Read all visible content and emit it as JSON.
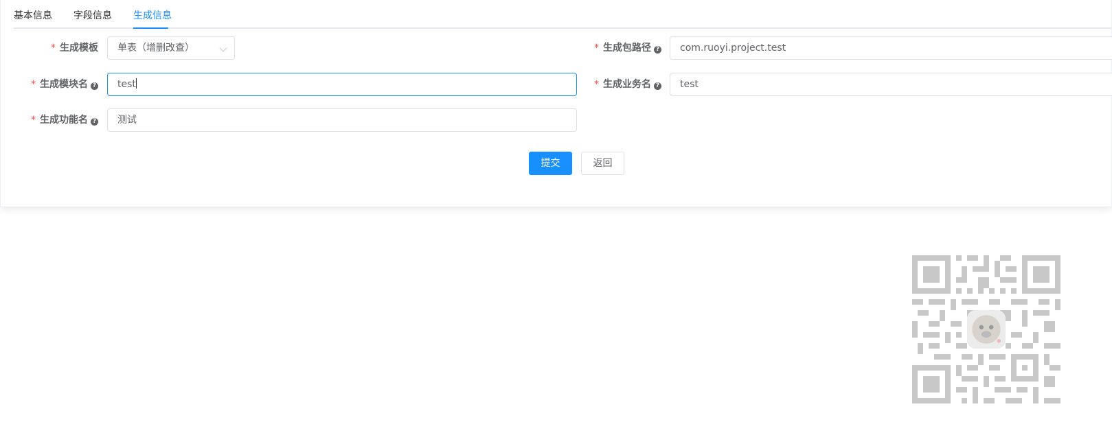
{
  "tabs": [
    {
      "label": "基本信息"
    },
    {
      "label": "字段信息"
    },
    {
      "label": "生成信息"
    }
  ],
  "form": {
    "required_mark": "*",
    "help_glyph": "?",
    "template": {
      "label": "生成模板",
      "value": "单表（增删改查）"
    },
    "package": {
      "label": "生成包路径",
      "value": "com.ruoyi.project.test"
    },
    "module": {
      "label": "生成模块名",
      "value": "test"
    },
    "business": {
      "label": "生成业务名",
      "value": "test"
    },
    "function": {
      "label": "生成功能名",
      "value": "测试"
    }
  },
  "buttons": {
    "submit": "提交",
    "back": "返回"
  },
  "colors": {
    "primary": "#1890ff",
    "required": "#ff4949"
  },
  "qr_code": {
    "icon": "qr-code-icon"
  }
}
